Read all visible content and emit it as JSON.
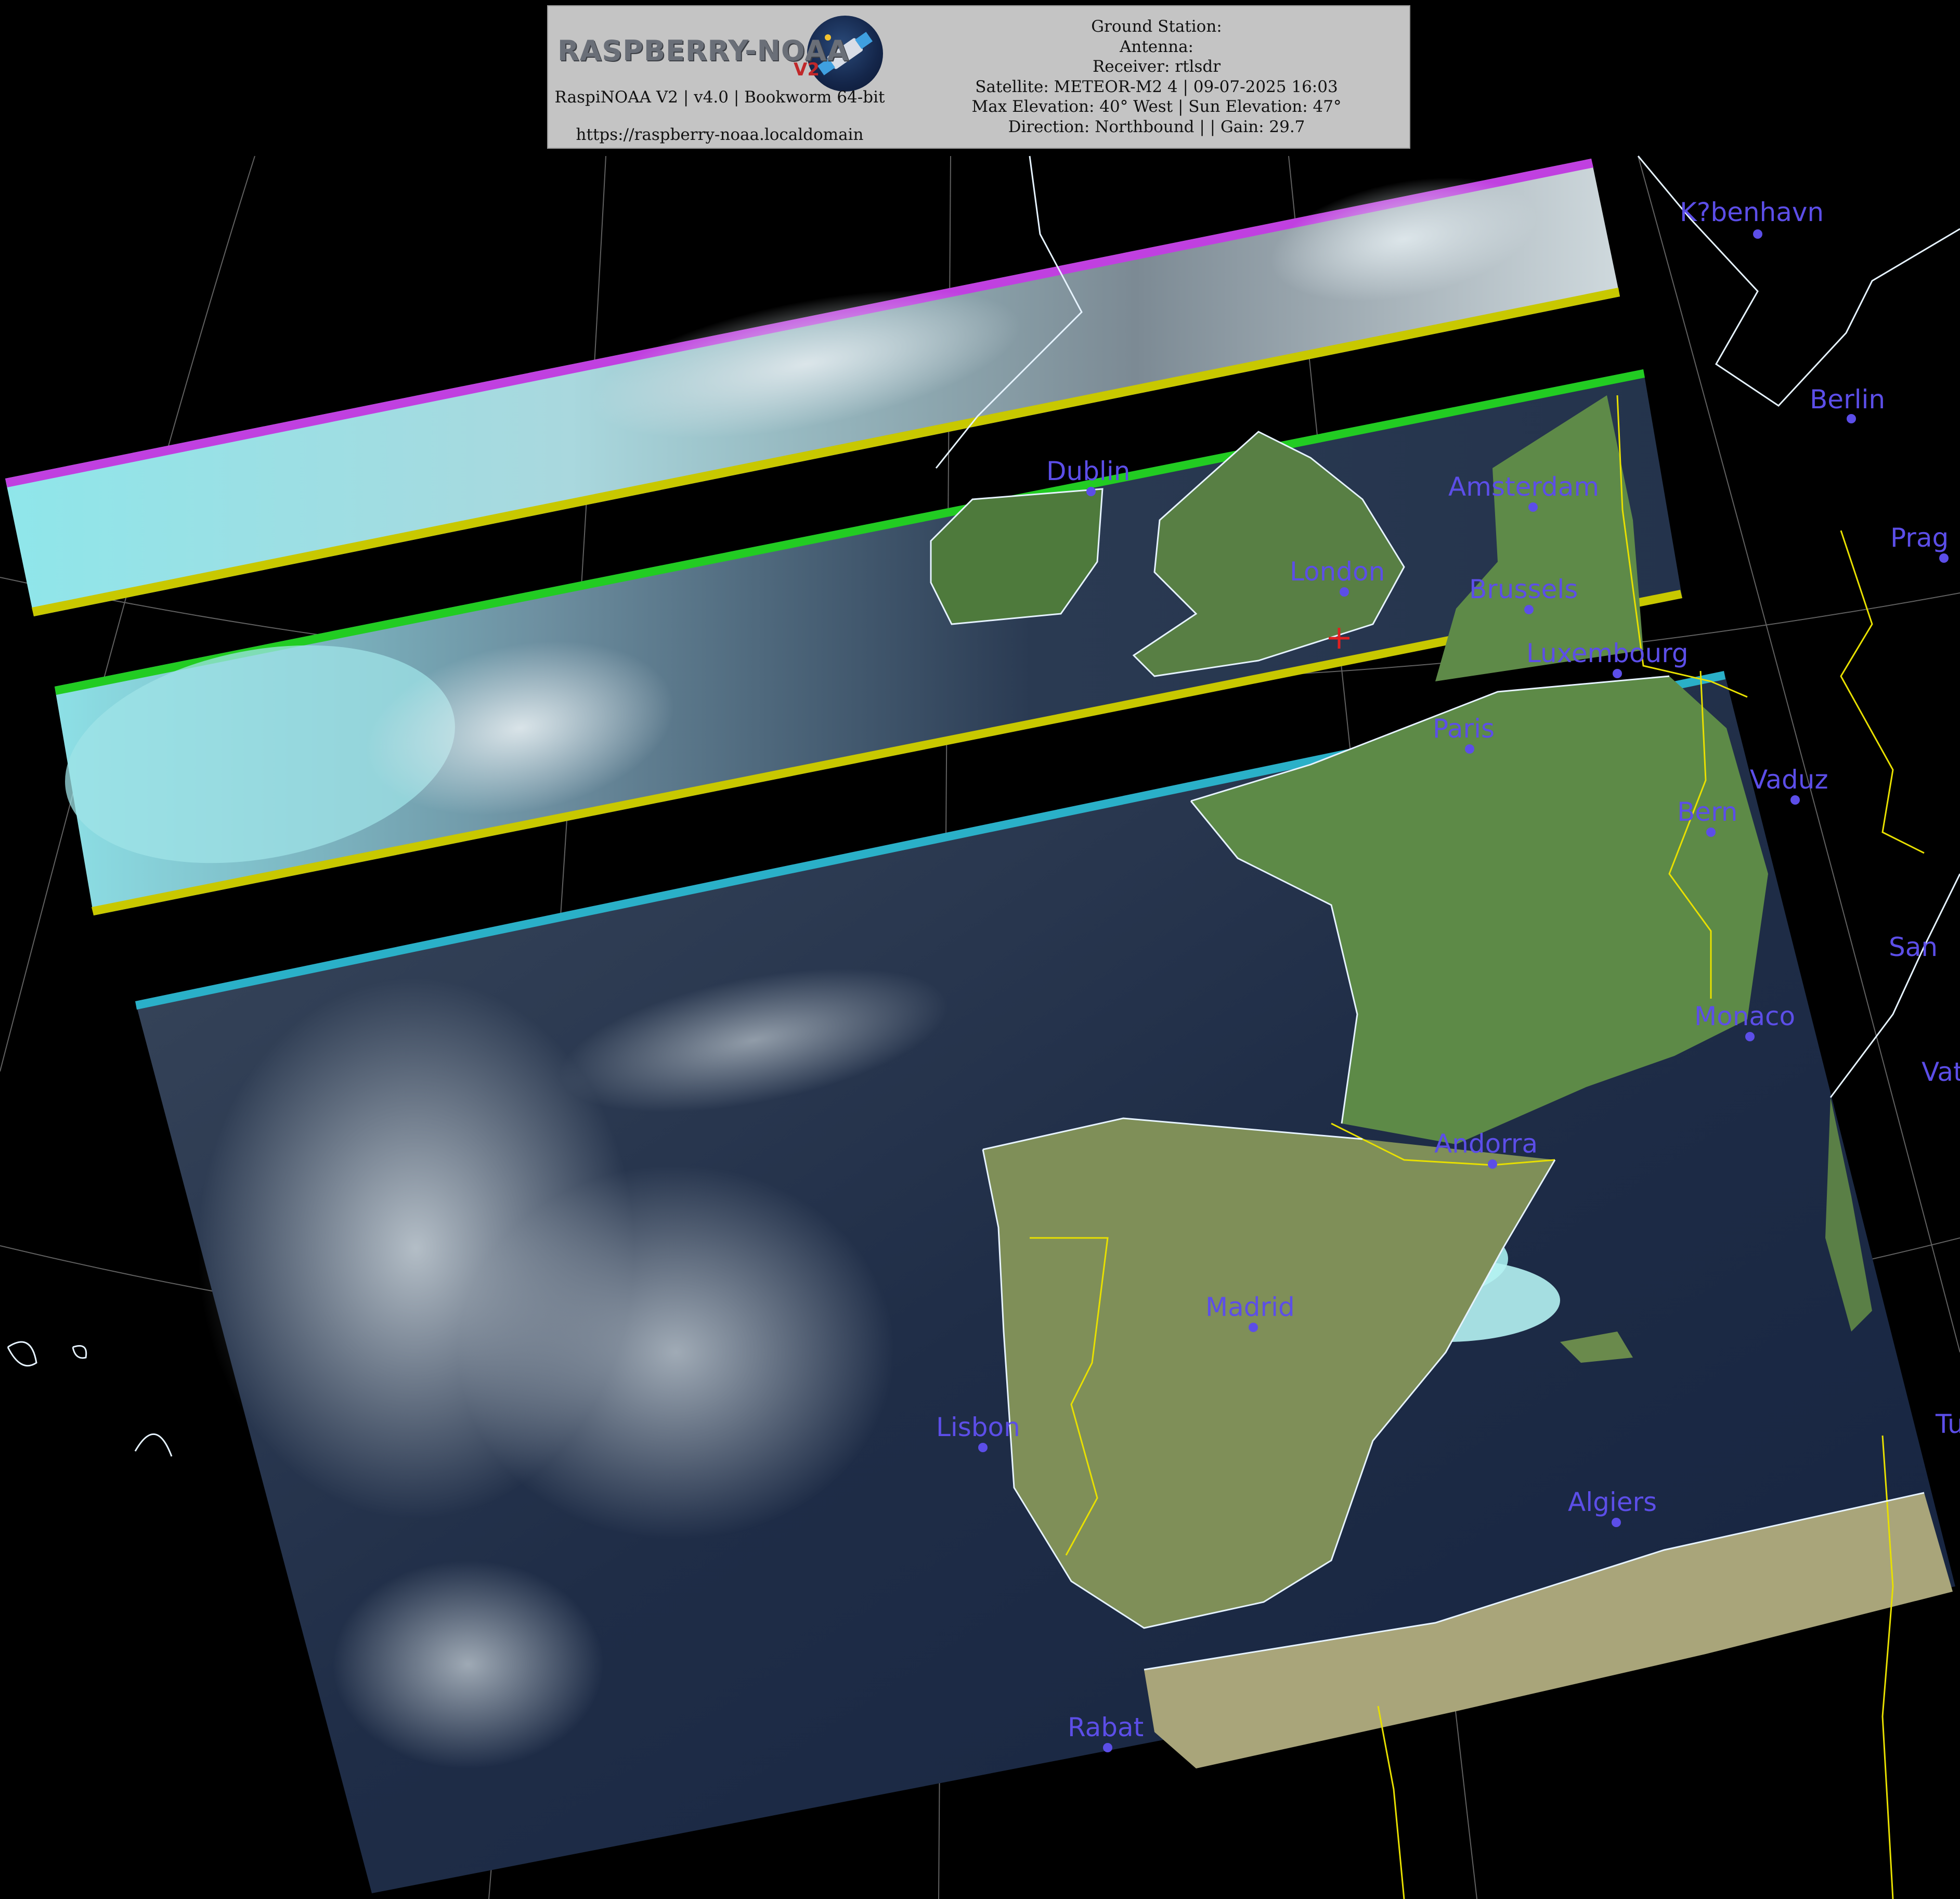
{
  "header": {
    "logo_text": "RASPBERRY-NOAA",
    "logo_badge": "V2",
    "app_info": "RaspiNOAA V2 | v4.0 | Bookworm 64-bit",
    "url": "https://raspberry-noaa.localdomain",
    "lines": [
      "Ground Station:",
      "Antenna:",
      "Receiver: rtlsdr",
      "Satellite: METEOR-M2 4 | 09-07-2025 16:03",
      "Max Elevation: 40° West | Sun Elevation: 47°",
      "Direction: Northbound | | Gain: 29.7"
    ]
  },
  "map": {
    "ground_station_marker": "red-cross",
    "colors": {
      "city": "#5c4ee8",
      "coastline": "#e6f3ff",
      "border": "#e8e000",
      "graticule": "#8a8a8a",
      "marker": "#e02020"
    },
    "cities": [
      {
        "name": "K?benhavn"
      },
      {
        "name": "Berlin"
      },
      {
        "name": "Dublin"
      },
      {
        "name": "Amsterdam"
      },
      {
        "name": "London"
      },
      {
        "name": "Brussels"
      },
      {
        "name": "Prag"
      },
      {
        "name": "Luxembourg"
      },
      {
        "name": "Paris"
      },
      {
        "name": "Vaduz"
      },
      {
        "name": "Bern"
      },
      {
        "name": "San"
      },
      {
        "name": "Monaco"
      },
      {
        "name": "Vat"
      },
      {
        "name": "Andorra"
      },
      {
        "name": "Madrid"
      },
      {
        "name": "Lisbon"
      },
      {
        "name": "Algiers"
      },
      {
        "name": "Rabat"
      },
      {
        "name": "Tu"
      }
    ]
  }
}
